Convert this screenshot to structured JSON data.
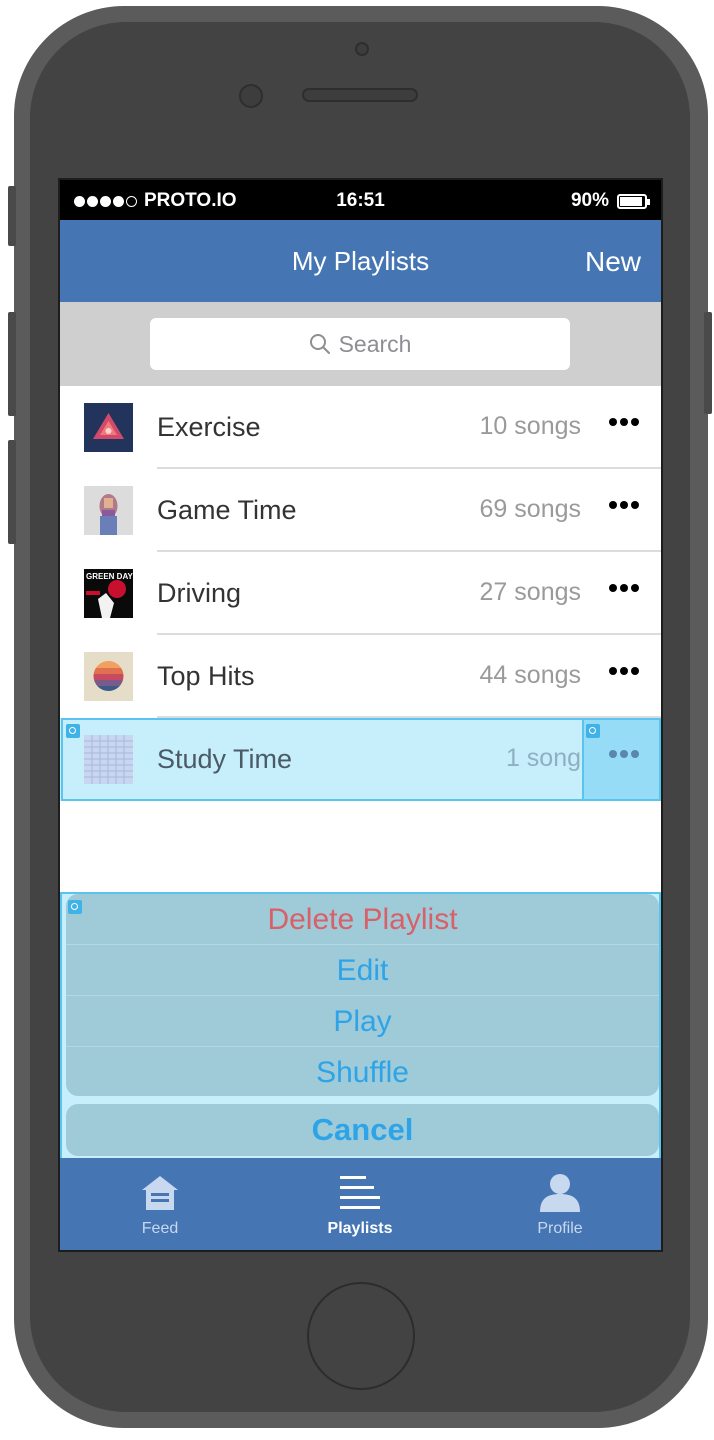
{
  "status_bar": {
    "carrier": "PROTO.IO",
    "time": "16:51",
    "battery": "90%",
    "battery_level": 0.9
  },
  "nav": {
    "title": "My Playlists",
    "new_label": "New"
  },
  "search": {
    "placeholder": "Search"
  },
  "playlists": [
    {
      "name": "Exercise",
      "count": "10 songs",
      "art": "triangle-art"
    },
    {
      "name": "Game Time",
      "count": "69 songs",
      "art": "portrait-art"
    },
    {
      "name": "Driving",
      "count": "27 songs",
      "art": "green-day-album-art"
    },
    {
      "name": "Top Hits",
      "count": "44 songs",
      "art": "sunset-art"
    },
    {
      "name": "Study Time",
      "count": "1 song",
      "art": "grid-art",
      "selected": true
    }
  ],
  "album_art_text": "GREEN DAY",
  "action_sheet": {
    "delete": "Delete Playlist",
    "edit": "Edit",
    "play": "Play",
    "shuffle": "Shuffle",
    "cancel": "Cancel"
  },
  "tabs": [
    {
      "label": "Feed",
      "icon": "home-icon"
    },
    {
      "label": "Playlists",
      "icon": "list-icon",
      "active": true
    },
    {
      "label": "Profile",
      "icon": "person-icon"
    }
  ],
  "colors": {
    "nav_blue": "#4576b3",
    "action_blue": "#2ea4e8",
    "destructive_red": "#d86068",
    "selection_highlight": "#c6eefb"
  }
}
